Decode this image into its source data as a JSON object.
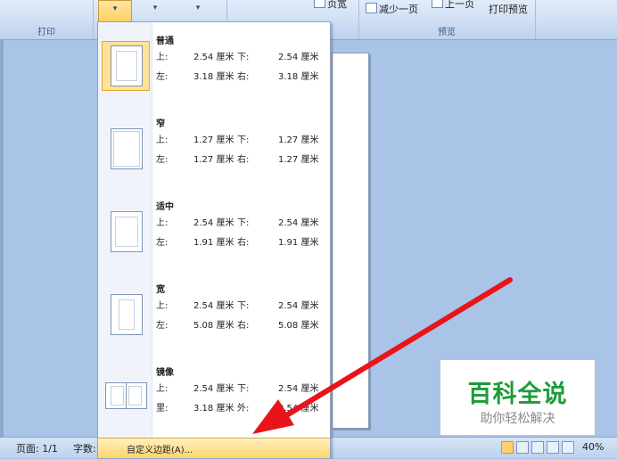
{
  "ribbon": {
    "print_group_label": "打印",
    "page_label": "页宽",
    "reduce_page": "减少一页",
    "prev_page": "上一页",
    "print_preview": "打印预览",
    "preview_group_label": "预览"
  },
  "margins_menu": {
    "presets": [
      {
        "name": "普通",
        "row1": {
          "l1": "上:",
          "v1": "2.54 厘米",
          "l2": "下:",
          "v2": "2.54 厘米"
        },
        "row2": {
          "l1": "左:",
          "v1": "3.18 厘米",
          "l2": "右:",
          "v2": "3.18 厘米"
        }
      },
      {
        "name": "窄",
        "row1": {
          "l1": "上:",
          "v1": "1.27 厘米",
          "l2": "下:",
          "v2": "1.27 厘米"
        },
        "row2": {
          "l1": "左:",
          "v1": "1.27 厘米",
          "l2": "右:",
          "v2": "1.27 厘米"
        }
      },
      {
        "name": "适中",
        "row1": {
          "l1": "上:",
          "v1": "2.54 厘米",
          "l2": "下:",
          "v2": "2.54 厘米"
        },
        "row2": {
          "l1": "左:",
          "v1": "1.91 厘米",
          "l2": "右:",
          "v2": "1.91 厘米"
        }
      },
      {
        "name": "宽",
        "row1": {
          "l1": "上:",
          "v1": "2.54 厘米",
          "l2": "下:",
          "v2": "2.54 厘米"
        },
        "row2": {
          "l1": "左:",
          "v1": "5.08 厘米",
          "l2": "右:",
          "v2": "5.08 厘米"
        }
      },
      {
        "name": "镜像",
        "row1": {
          "l1": "上:",
          "v1": "2.54 厘米",
          "l2": "下:",
          "v2": "2.54 厘米"
        },
        "row2": {
          "l1": "里:",
          "v1": "3.18 厘米",
          "l2": "外:",
          "v2": "2.54 厘米"
        }
      }
    ],
    "custom_label": "自定义边距(A)..."
  },
  "status_bar": {
    "page_info": "页面: 1/1",
    "word_count": "字数:",
    "zoom": "40%"
  },
  "watermark": {
    "title": "百科全说",
    "subtitle": "助你轻松解决"
  },
  "colors": {
    "arrow": "#e8141a",
    "watermark_green": "#1f9b3a",
    "selection": "#ffe19a"
  }
}
